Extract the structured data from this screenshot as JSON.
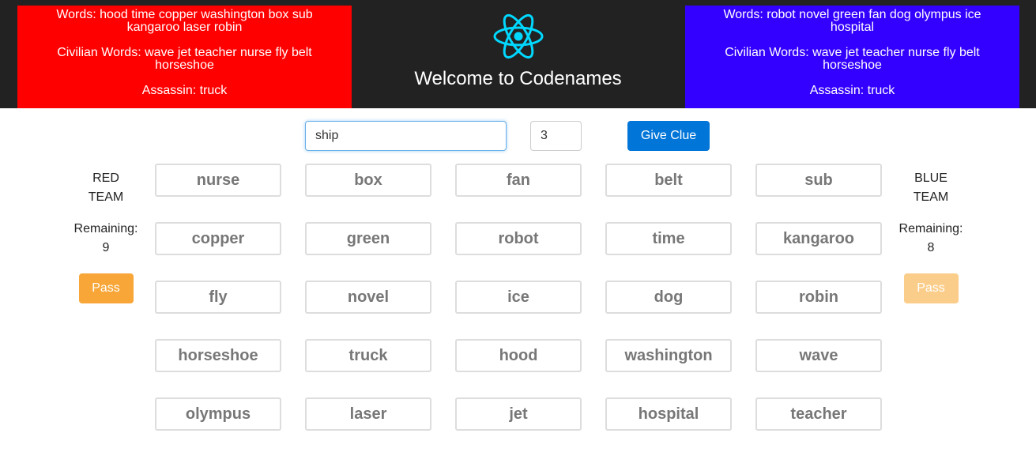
{
  "header": {
    "title": "Welcome to Codenames",
    "logo_icon": "react-atom-logo",
    "red_key": {
      "color": "#ff0000",
      "words": "Words: hood time copper washington box sub kangaroo laser robin",
      "civilian": "Civilian Words: wave jet teacher nurse fly belt horseshoe",
      "assassin": "Assassin: truck"
    },
    "blue_key": {
      "color": "#3300ff",
      "words": "Words: robot novel green fan dog olympus ice hospital",
      "civilian": "Civilian Words: wave jet teacher nurse fly belt horseshoe",
      "assassin": "Assassin: truck"
    }
  },
  "clue": {
    "word_value": "ship",
    "count_value": "3",
    "submit_label": "Give Clue"
  },
  "red_team": {
    "name": "RED TEAM",
    "remaining_label": "Remaining:",
    "remaining": "9",
    "pass_label": "Pass"
  },
  "blue_team": {
    "name": "BLUE TEAM",
    "remaining_label": "Remaining:",
    "remaining": "8",
    "pass_label": "Pass"
  },
  "board": {
    "cards": [
      "nurse",
      "box",
      "fan",
      "belt",
      "sub",
      "copper",
      "green",
      "robot",
      "time",
      "kangaroo",
      "fly",
      "novel",
      "ice",
      "dog",
      "robin",
      "horseshoe",
      "truck",
      "hood",
      "washington",
      "wave",
      "olympus",
      "laser",
      "jet",
      "hospital",
      "teacher"
    ]
  }
}
